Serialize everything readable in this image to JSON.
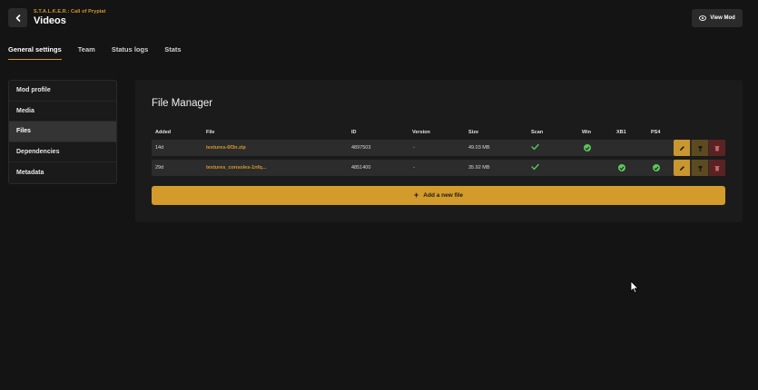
{
  "header": {
    "subtitle": "S.T.A.L.K.E.R.: Call of Prypiat",
    "title": "Videos",
    "view_mod_label": "View Mod"
  },
  "tabs": [
    {
      "label": "General settings",
      "active": true
    },
    {
      "label": "Team",
      "active": false
    },
    {
      "label": "Status logs",
      "active": false
    },
    {
      "label": "Stats",
      "active": false
    }
  ],
  "sidebar": {
    "items": [
      {
        "label": "Mod profile",
        "active": false
      },
      {
        "label": "Media",
        "active": false
      },
      {
        "label": "Files",
        "active": true
      },
      {
        "label": "Dependencies",
        "active": false
      },
      {
        "label": "Metadata",
        "active": false
      }
    ]
  },
  "file_manager": {
    "title": "File Manager",
    "columns": [
      "Added",
      "File",
      "ID",
      "Version",
      "Size",
      "Scan",
      "Win",
      "XB1",
      "PS4"
    ],
    "rows": [
      {
        "added": "14d",
        "file": "textures-6f3n.zip",
        "id": "4897503",
        "version": "-",
        "size": "49.03 MB",
        "scan": true,
        "win": true,
        "xb1": false,
        "ps4": false
      },
      {
        "added": "29d",
        "file": "textures_consoles-1nfq...",
        "id": "4851400",
        "version": "-",
        "size": "35.92 MB",
        "scan": true,
        "win": false,
        "xb1": true,
        "ps4": true
      }
    ],
    "add_label": "Add a new file"
  },
  "icons": {
    "back": "chevron-left-icon",
    "view": "eye-icon",
    "check": "check-icon",
    "platform": "check-circle-icon",
    "edit": "pencil-icon",
    "feature": "trophy-icon",
    "delete": "trash-icon",
    "add": "plus-icon"
  },
  "colors": {
    "accent": "#d39a2c",
    "success": "#5cc45c",
    "danger": "#5a2323",
    "background": "#141414"
  }
}
